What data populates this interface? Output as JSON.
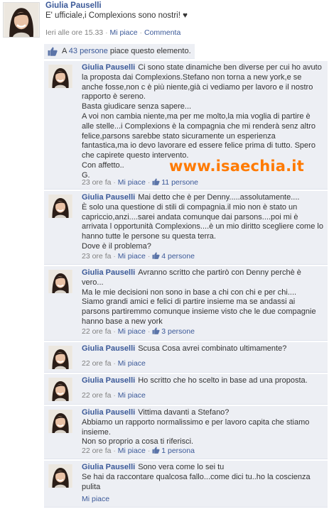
{
  "post": {
    "author": "Giulia Pauselli",
    "text": "E' ufficiale,i Complexions sono nostri! ♥",
    "time": "Ieri alle ore 15.33",
    "like_label": "Mi piace",
    "comment_label": "Commenta"
  },
  "likes": {
    "prefix": "A ",
    "count_link": "43 persone",
    "suffix": " piace questo elemento."
  },
  "comments": [
    {
      "author": "Giulia Pauselli",
      "text": "Ci sono state dinamiche ben diverse per cui ho avuto la proposta dai Complexions.Stefano non torna a new york,e se anche fosse,non c è più niente,già ci vediamo per lavoro e il nostro rapporto è sereno.\nBasta giudicare senza sapere...\nA voi non cambia niente,ma per me molto,la mia voglia di partire è alle stelle...i Complexions è la compagnia che mi renderà senz altro felice,parsons sarebbe stato sicuramente un esperienza fantastica,ma io devo lavorare ed essere felice prima di tutto. Spero che capirete questo intervento.\nCon affetto..\nG.",
      "time": "23 ore fa",
      "like_label": "Mi piace",
      "likes": "11 persone"
    },
    {
      "author": "Giulia Pauselli",
      "text": "Mai detto che è per Denny.....assolutamente....\nÈ solo una questione di stili di compagnia.il mio non è stato un capriccio,anzi....sarei andata comunque dai parsons....poi mi è arrivata l opportunità Complexions....è un mio diritto scegliere come lo hanno tutte le persone su questa terra.\nDove è il problema?",
      "time": "23 ore fa",
      "like_label": "Mi piace",
      "likes": "4 persone"
    },
    {
      "author": "Giulia Pauselli",
      "text": "Avranno scritto che partirò con Denny perchè è vero...\nMa le mie decisioni non sono in base a chi con chi e per chi....\nSiamo grandi amici e felici di partire insieme ma se andassi ai parsons partiremmo comunque insieme visto che le due compagnie hanno base a new york",
      "time": "22 ore fa",
      "like_label": "Mi piace",
      "likes": "3 persone"
    },
    {
      "author": "Giulia Pauselli",
      "text": "Scusa Cosa avrei combinato ultimamente?",
      "time": "22 ore fa",
      "like_label": "Mi piace",
      "likes": ""
    },
    {
      "author": "Giulia Pauselli",
      "text": "Ho scritto che ho scelto in base ad una proposta.",
      "time": "22 ore fa",
      "like_label": "Mi piace",
      "likes": ""
    },
    {
      "author": "Giulia Pauselli",
      "text": "Vittima davanti a Stefano?\nAbbiamo un rapporto normalissimo e per lavoro capita che stiamo insieme.\nNon so proprio a cosa ti riferisci.",
      "time": "22 ore fa",
      "like_label": "Mi piace",
      "likes": "1 persona"
    },
    {
      "author": "Giulia Pauselli",
      "text": "Sono vera come lo sei tu\nSe hai da raccontare qualcosa fallo...come dici tu..ho la coscienza pulita",
      "time": "22 ore fa",
      "like_label": "Mi piace",
      "likes": ""
    }
  ],
  "watermark": "www.isaechia.it",
  "colors": {
    "link": "#3b5998",
    "comment_bg": "#edeff4",
    "meta": "#808080",
    "watermark": "#ff7a00"
  },
  "icons": [
    "thumbs-up-icon",
    "avatar-photo"
  ]
}
